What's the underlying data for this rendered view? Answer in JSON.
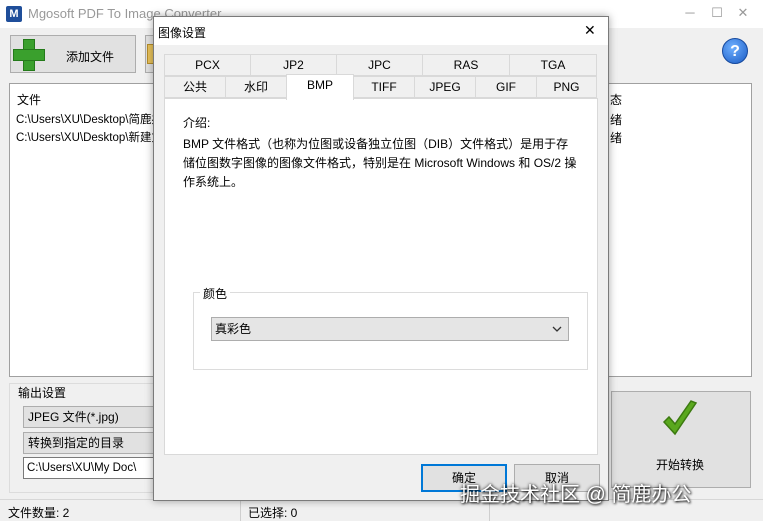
{
  "window": {
    "title": "Mgosoft PDF To Image Converter",
    "icon_letter": "M",
    "minimize": "─",
    "maximize": "☐",
    "close": "✕"
  },
  "toolbar": {
    "add_files_label": "添加文件",
    "help_icon": "?"
  },
  "file_list": {
    "header_file": "文件",
    "header_status_fragment": "态",
    "rows": [
      {
        "path": "C:\\Users\\XU\\Desktop\\简鹿办",
        "status_fragment": "绪"
      },
      {
        "path": "C:\\Users\\XU\\Desktop\\新建文",
        "status_fragment": "绪"
      }
    ]
  },
  "output": {
    "section_label": "输出设置",
    "format_value": "JPEG 文件(*.jpg)",
    "mode_value": "转换到指定的目录",
    "path_value": "C:\\Users\\XU\\My Doc\\"
  },
  "start_button_label": "开始转换",
  "statusbar": {
    "file_count": "文件数量: 2",
    "selected": "已选择: 0"
  },
  "dialog": {
    "title": "图像设置",
    "close": "✕",
    "tabs_row1": [
      "PCX",
      "JP2",
      "JPC",
      "RAS",
      "TGA"
    ],
    "tabs_row2": [
      "公共",
      "水印",
      "BMP",
      "TIFF",
      "JPEG",
      "GIF",
      "PNG"
    ],
    "active_tab": "BMP",
    "intro_label": "介绍:",
    "intro_text": "BMP 文件格式（也称为位图或设备独立位图（DIB）文件格式）是用于存储位图数字图像的图像文件格式，特别是在 Microsoft Windows 和 OS/2 操作系统上。",
    "color_group_label": "颜色",
    "color_value": "真彩色",
    "ok_label": "确定",
    "cancel_label": "取消"
  },
  "watermark": "掘金技术社区 @ 简鹿办公",
  "colors": {
    "accent": "#0078d7",
    "plus_green": "#3aa02d",
    "check_green": "#5aa81e",
    "help_blue": "#1a5bc4"
  }
}
